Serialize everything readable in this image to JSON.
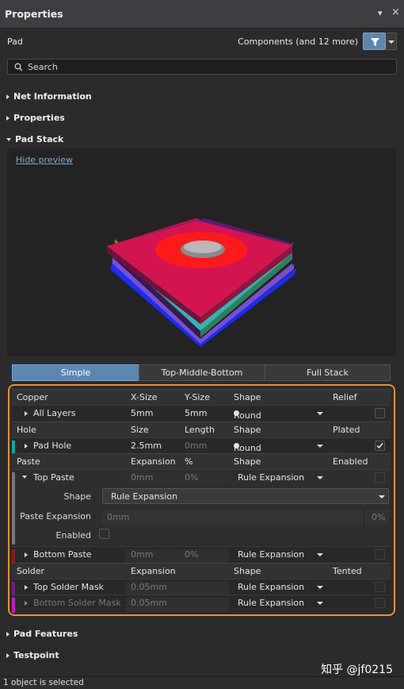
{
  "window": {
    "title": "Properties",
    "pin": "▾",
    "close": "×"
  },
  "object": {
    "type": "Pad",
    "filter_text": "Components (and 12 more)"
  },
  "search": {
    "placeholder": "Search"
  },
  "sections": {
    "net": "Net Information",
    "properties": "Properties",
    "padstack": "Pad Stack",
    "features": "Pad Features",
    "testpoint": "Testpoint"
  },
  "preview": {
    "hide": "Hide preview"
  },
  "tabs": [
    "Simple",
    "Top-Middle-Bottom",
    "Full Stack"
  ],
  "copper": {
    "header": [
      "Copper",
      "X-Size",
      "Y-Size",
      "Shape",
      "Relief"
    ],
    "row": {
      "name": "All Layers",
      "x": "5mm",
      "y": "5mm",
      "shape": "Round"
    }
  },
  "hole": {
    "header": [
      "Hole",
      "Size",
      "Length",
      "Shape",
      "Plated"
    ],
    "row": {
      "name": "Pad Hole",
      "size": "2.5mm",
      "length": "0mm",
      "shape": "Round"
    }
  },
  "paste": {
    "header": [
      "Paste",
      "Expansion",
      "%",
      "Shape",
      "Enabled"
    ],
    "top": {
      "name": "Top Paste",
      "exp": "0mm",
      "pct": "0%",
      "shape": "Rule Expansion"
    },
    "detail": {
      "shape_label": "Shape",
      "shape_value": "Rule Expansion",
      "exp_label": "Paste Expansion",
      "exp_value": "0mm",
      "exp_pct": "0%",
      "enabled_label": "Enabled"
    },
    "bottom": {
      "name": "Bottom Paste",
      "exp": "0mm",
      "pct": "0%",
      "shape": "Rule Expansion"
    }
  },
  "solder": {
    "header": [
      "Solder",
      "Expansion",
      "Shape",
      "Tented"
    ],
    "top": {
      "name": "Top Solder Mask",
      "exp": "0.05mm",
      "shape": "Rule Expansion"
    },
    "bottom": {
      "name": "Bottom Solder Mask",
      "exp": "0.05mm",
      "shape": "Rule Expansion"
    }
  },
  "status": "1 object is selected",
  "watermark": "知乎 @jf0215",
  "colors": {
    "accent": "#5b87b5",
    "highlight": "#e9902a",
    "copper_bar": "#1aa59a",
    "hole_bar": "#1aa59a",
    "bottom_paste_bar": "#8b1a1a",
    "top_solder_bar": "#6b2080",
    "bottom_solder_bar": "#c020c0"
  }
}
